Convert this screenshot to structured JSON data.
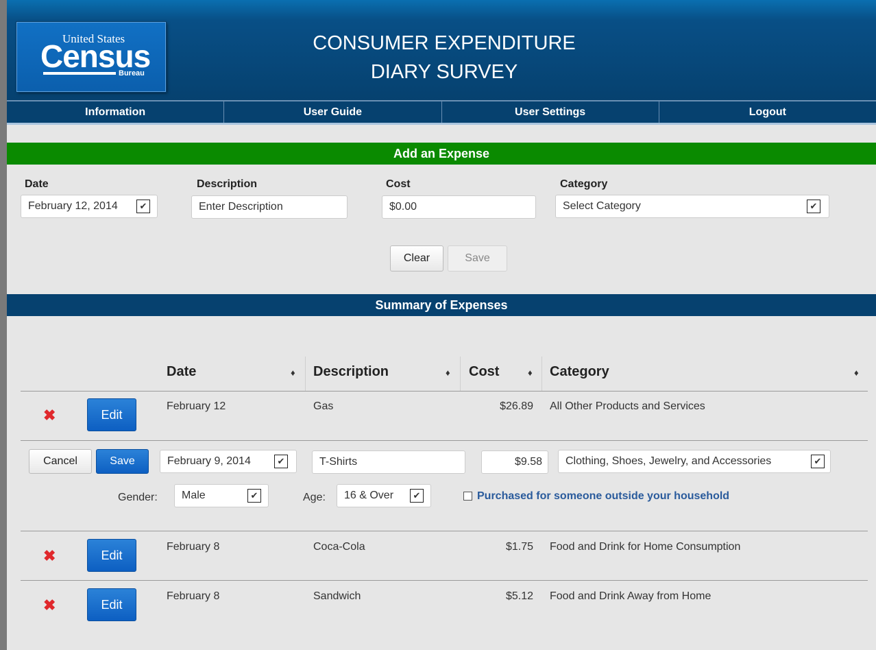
{
  "header": {
    "logo": {
      "top": "United States",
      "main": "Census",
      "sub": "Bureau"
    },
    "title_line1": "CONSUMER EXPENDITURE",
    "title_line2": "DIARY SURVEY"
  },
  "nav": {
    "items": [
      "Information",
      "User Guide",
      "User Settings",
      "Logout"
    ]
  },
  "add_expense": {
    "heading": "Add an Expense",
    "labels": {
      "date": "Date",
      "description": "Description",
      "cost": "Cost",
      "category": "Category"
    },
    "date_value": "February 12, 2014",
    "description_placeholder": "Enter Description",
    "cost_value": "$0.00",
    "category_value": "Select Category",
    "clear_label": "Clear",
    "save_label": "Save"
  },
  "summary": {
    "heading": "Summary of Expenses",
    "columns": [
      "Date",
      "Description",
      "Cost",
      "Category"
    ],
    "rows": [
      {
        "date": "February 12",
        "description": "Gas",
        "cost": "$26.89",
        "category": "All Other Products and Services"
      },
      {
        "date": "February 8",
        "description": "Coca-Cola",
        "cost": "$1.75",
        "category": "Food and Drink for Home Consumption"
      },
      {
        "date": "February 8",
        "description": "Sandwich",
        "cost": "$5.12",
        "category": "Food and Drink Away from Home"
      }
    ],
    "edit_label": "Edit",
    "editing_row": {
      "cancel_label": "Cancel",
      "save_label": "Save",
      "date_value": "February 9, 2014",
      "description_value": "T-Shirts",
      "cost_value": "$9.58",
      "category_value": "Clothing, Shoes, Jewelry, and Accessories",
      "gender_label": "Gender:",
      "gender_value": "Male",
      "age_label": "Age:",
      "age_value": "16 & Over",
      "outside_household_label": "Purchased for someone outside your household"
    }
  },
  "icons": {
    "delete": "x-icon",
    "select": "chevron-down-icon",
    "sort": "sort-icon"
  },
  "colors": {
    "header_blue": "#06416f",
    "green_bar": "#0a8a00",
    "edit_blue": "#0d5fc2",
    "delete_red": "#e0282c"
  }
}
